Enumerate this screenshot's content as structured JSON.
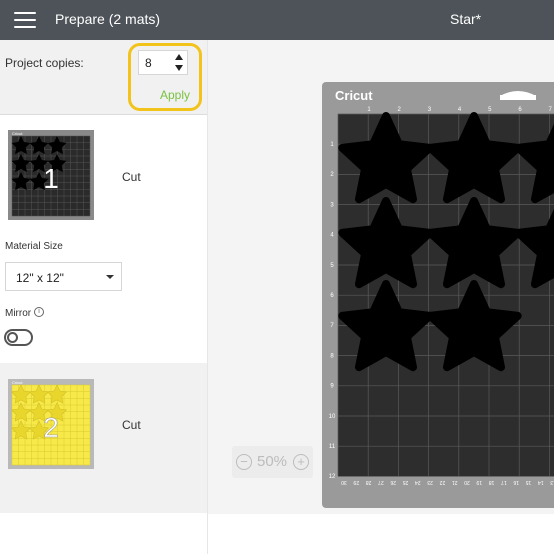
{
  "header": {
    "title": "Prepare (2 mats)",
    "project_name": "Star*",
    "menu_icon": "hamburger-menu-icon",
    "background": "#4d5358"
  },
  "copies": {
    "label": "Project copies:",
    "value": "8",
    "apply_label": "Apply",
    "highlight_color": "#f2c31a",
    "apply_color": "#7ac142"
  },
  "mats": [
    {
      "number": "1",
      "action": "Cut",
      "mat_color": "#2b2b2b",
      "stars": 8
    },
    {
      "number": "2",
      "action": "Cut",
      "mat_color": "#f7e94a",
      "stars": 8
    }
  ],
  "material": {
    "label": "Material Size",
    "value": "12\" x 12\""
  },
  "mirror": {
    "label": "Mirror",
    "info_icon": "info-icon",
    "enabled": false
  },
  "canvas": {
    "zoom": "50%",
    "mat_brand": "Cricut",
    "ruler_top": [
      "1",
      "2",
      "3",
      "4",
      "5",
      "6",
      "7"
    ],
    "ruler_left": [
      "1",
      "2",
      "3",
      "4",
      "5",
      "6",
      "7",
      "8",
      "9",
      "10",
      "11",
      "12"
    ],
    "ruler_bottom": [
      "30",
      "29",
      "28",
      "27",
      "26",
      "25",
      "24",
      "23",
      "22",
      "21",
      "20",
      "19",
      "18",
      "17",
      "16",
      "15",
      "14",
      "13"
    ],
    "stars_shown": 8,
    "mat_color": "#2d2d2d",
    "frame_color": "#9a9a9a"
  }
}
